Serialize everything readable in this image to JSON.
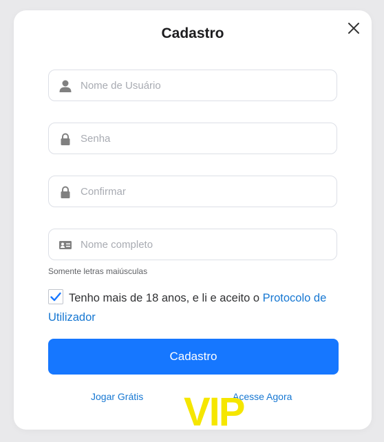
{
  "dialog": {
    "title": "Cadastro",
    "close_icon": "close-icon"
  },
  "form": {
    "username": {
      "placeholder": "Nome de Usuário",
      "value": "",
      "icon": "user-icon"
    },
    "password": {
      "placeholder": "Senha",
      "value": "",
      "icon": "lock-icon"
    },
    "confirm": {
      "placeholder": "Confirmar",
      "value": "",
      "icon": "lock-icon"
    },
    "fullname": {
      "placeholder": "Nome completo",
      "value": "",
      "icon": "id-card-icon"
    },
    "fullname_hint": "Somente letras maiúsculas"
  },
  "agreement": {
    "checked": true,
    "text": "Tenho mais de 18 anos, e li e aceito o",
    "link": "Protocolo de Utilizador"
  },
  "submit_label": "Cadastro",
  "footer": {
    "left_link": "Jogar Grátis",
    "right_link": "Acesse Agora",
    "badge": "VIP"
  },
  "colors": {
    "primary": "#1677ff",
    "link": "#1677d2",
    "badge": "#f5e600"
  }
}
